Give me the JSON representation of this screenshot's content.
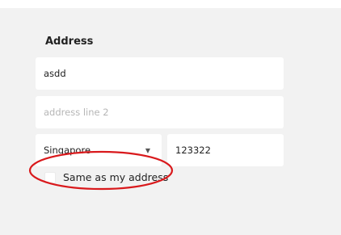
{
  "address": {
    "title": "Address",
    "line1_value": "asdd",
    "line2_placeholder": "address line 2",
    "country_selected": "Singapore",
    "postal_value": "123322",
    "same_as_label": "Same as my address"
  },
  "annotation": {
    "ellipse_color": "#d9191c"
  }
}
